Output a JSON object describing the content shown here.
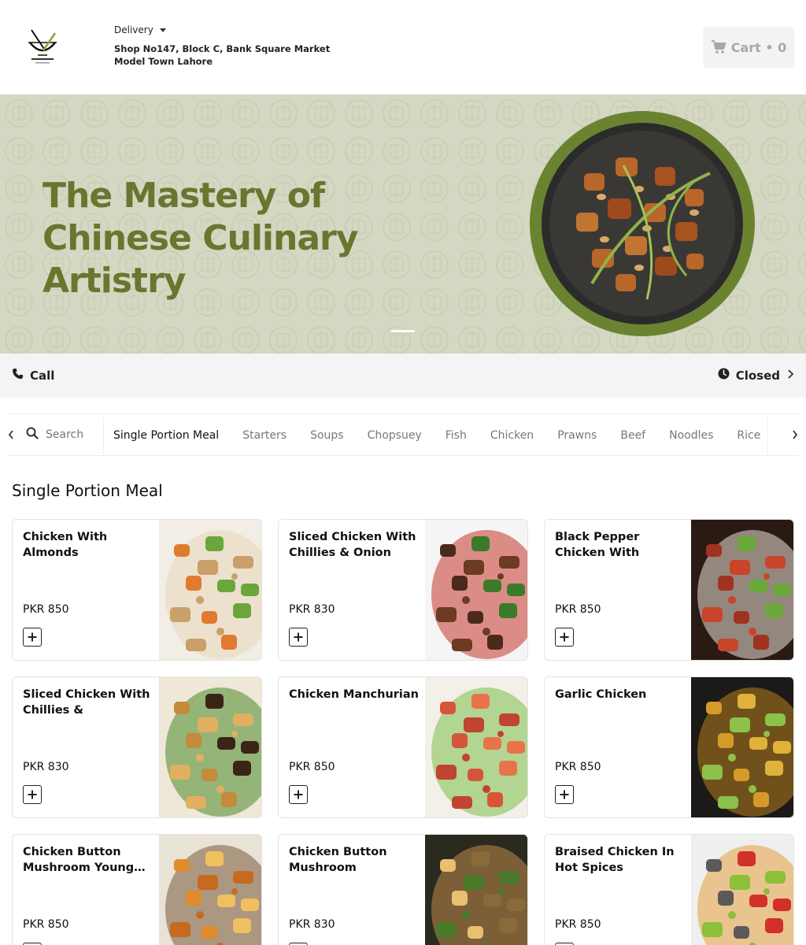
{
  "header": {
    "delivery_label": "Delivery",
    "address": "Shop No147, Block C, Bank Square Market Model Town Lahore",
    "cart_label": "Cart • 0"
  },
  "banner": {
    "headline": "The Mastery of Chinese Culinary Artistry"
  },
  "info": {
    "call_label": "Call",
    "status_label": "Closed"
  },
  "nav": {
    "search_placeholder": "Search",
    "tabs": [
      "Single Portion Meal",
      "Starters",
      "Soups",
      "Chopsuey",
      "Fish",
      "Chicken",
      "Prawns",
      "Beef",
      "Noodles",
      "Rice"
    ],
    "active_tab": "Single Portion Meal"
  },
  "section": {
    "title": "Single Portion Meal"
  },
  "items": [
    {
      "name": "Chicken With Almonds",
      "price": "PKR 850"
    },
    {
      "name": "Sliced Chicken With Chillies & Onion",
      "price": "PKR 830"
    },
    {
      "name": "Black Pepper Chicken With Chillies & Onion",
      "price": "PKR 850"
    },
    {
      "name": "Sliced Chicken With Chillies & Vegetables",
      "price": "PKR 830"
    },
    {
      "name": "Chicken Manchurian",
      "price": "PKR 850"
    },
    {
      "name": "Garlic Chicken",
      "price": "PKR 850"
    },
    {
      "name": "Chicken Button Mushroom Young…",
      "price": "PKR 850"
    },
    {
      "name": "Chicken Button Mushroom",
      "price": "PKR 830"
    },
    {
      "name": "Braised Chicken In Hot Spices",
      "price": "PKR 850"
    }
  ],
  "colors": {
    "banner_bg": "#d4d7c1",
    "headline": "#6a7530",
    "plate_rim": "#6b8330",
    "cart_bg": "#f3f3f3",
    "infobar_bg": "#f4f4f4"
  },
  "icons": {
    "logo": "wok-logo",
    "cart": "cart-icon",
    "call": "phone-icon",
    "status": "clock-icon",
    "search": "search-icon",
    "add": "plus-icon"
  }
}
